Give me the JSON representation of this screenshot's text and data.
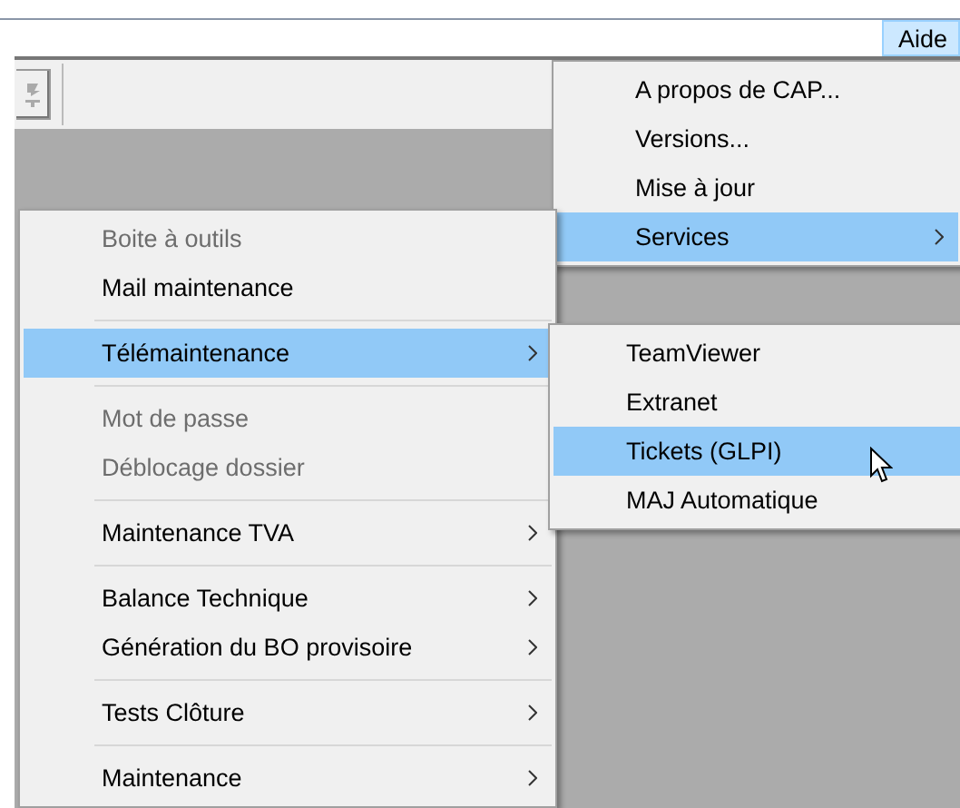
{
  "menubar": {
    "items": [
      {
        "label": "Aide",
        "selected": true
      }
    ]
  },
  "help_menu": {
    "items": [
      {
        "kind": "item",
        "label": "A propos de CAP...",
        "disabled": false,
        "selected": false,
        "submenu": false
      },
      {
        "kind": "item",
        "label": "Versions...",
        "disabled": false,
        "selected": false,
        "submenu": false
      },
      {
        "kind": "item",
        "label": "Mise à jour",
        "disabled": false,
        "selected": false,
        "submenu": false
      },
      {
        "kind": "item",
        "label": "Services",
        "disabled": false,
        "selected": true,
        "submenu": true
      }
    ]
  },
  "services_menu": {
    "items": [
      {
        "kind": "item",
        "label": "Boite à outils",
        "disabled": true,
        "selected": false,
        "submenu": false
      },
      {
        "kind": "item",
        "label": "Mail maintenance",
        "disabled": false,
        "selected": false,
        "submenu": false
      },
      {
        "kind": "separator"
      },
      {
        "kind": "item",
        "label": "Télémaintenance",
        "disabled": false,
        "selected": true,
        "submenu": true
      },
      {
        "kind": "separator"
      },
      {
        "kind": "item",
        "label": "Mot de passe",
        "disabled": true,
        "selected": false,
        "submenu": false
      },
      {
        "kind": "item",
        "label": "Déblocage dossier",
        "disabled": true,
        "selected": false,
        "submenu": false
      },
      {
        "kind": "separator"
      },
      {
        "kind": "item",
        "label": "Maintenance TVA",
        "disabled": false,
        "selected": false,
        "submenu": true
      },
      {
        "kind": "separator"
      },
      {
        "kind": "item",
        "label": "Balance Technique",
        "disabled": false,
        "selected": false,
        "submenu": true
      },
      {
        "kind": "item",
        "label": "Génération du BO provisoire",
        "disabled": false,
        "selected": false,
        "submenu": true
      },
      {
        "kind": "separator"
      },
      {
        "kind": "item",
        "label": "Tests Clôture",
        "disabled": false,
        "selected": false,
        "submenu": true
      },
      {
        "kind": "separator"
      },
      {
        "kind": "item",
        "label": "Maintenance",
        "disabled": false,
        "selected": false,
        "submenu": true
      }
    ]
  },
  "telemaintenance_menu": {
    "items": [
      {
        "kind": "item",
        "label": "TeamViewer",
        "disabled": false,
        "selected": false,
        "submenu": false
      },
      {
        "kind": "item",
        "label": "Extranet",
        "disabled": false,
        "selected": false,
        "submenu": false
      },
      {
        "kind": "item",
        "label": "Tickets (GLPI)",
        "disabled": false,
        "selected": true,
        "submenu": false
      },
      {
        "kind": "item",
        "label": "MAJ Automatique",
        "disabled": false,
        "selected": false,
        "submenu": false
      }
    ]
  }
}
